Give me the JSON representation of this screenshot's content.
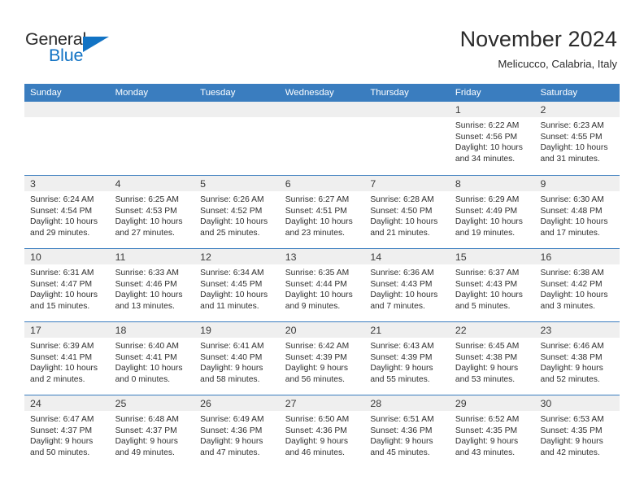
{
  "brand": {
    "name_part1": "General",
    "name_part2": "Blue",
    "color_dark": "#2b2b2b",
    "color_blue": "#1273c4"
  },
  "header": {
    "title": "November 2024",
    "location": "Melicucco, Calabria, Italy"
  },
  "theme": {
    "header_row_bg": "#3a7dbf",
    "day_band_bg": "#efefef",
    "row_divider": "#3a7dbf",
    "text": "#2b2b2b"
  },
  "weekdays": [
    "Sunday",
    "Monday",
    "Tuesday",
    "Wednesday",
    "Thursday",
    "Friday",
    "Saturday"
  ],
  "weeks": [
    [
      {
        "day": "",
        "sunrise": "",
        "sunset": "",
        "daylight_1": "",
        "daylight_2": ""
      },
      {
        "day": "",
        "sunrise": "",
        "sunset": "",
        "daylight_1": "",
        "daylight_2": ""
      },
      {
        "day": "",
        "sunrise": "",
        "sunset": "",
        "daylight_1": "",
        "daylight_2": ""
      },
      {
        "day": "",
        "sunrise": "",
        "sunset": "",
        "daylight_1": "",
        "daylight_2": ""
      },
      {
        "day": "",
        "sunrise": "",
        "sunset": "",
        "daylight_1": "",
        "daylight_2": ""
      },
      {
        "day": "1",
        "sunrise": "Sunrise: 6:22 AM",
        "sunset": "Sunset: 4:56 PM",
        "daylight_1": "Daylight: 10 hours",
        "daylight_2": "and 34 minutes."
      },
      {
        "day": "2",
        "sunrise": "Sunrise: 6:23 AM",
        "sunset": "Sunset: 4:55 PM",
        "daylight_1": "Daylight: 10 hours",
        "daylight_2": "and 31 minutes."
      }
    ],
    [
      {
        "day": "3",
        "sunrise": "Sunrise: 6:24 AM",
        "sunset": "Sunset: 4:54 PM",
        "daylight_1": "Daylight: 10 hours",
        "daylight_2": "and 29 minutes."
      },
      {
        "day": "4",
        "sunrise": "Sunrise: 6:25 AM",
        "sunset": "Sunset: 4:53 PM",
        "daylight_1": "Daylight: 10 hours",
        "daylight_2": "and 27 minutes."
      },
      {
        "day": "5",
        "sunrise": "Sunrise: 6:26 AM",
        "sunset": "Sunset: 4:52 PM",
        "daylight_1": "Daylight: 10 hours",
        "daylight_2": "and 25 minutes."
      },
      {
        "day": "6",
        "sunrise": "Sunrise: 6:27 AM",
        "sunset": "Sunset: 4:51 PM",
        "daylight_1": "Daylight: 10 hours",
        "daylight_2": "and 23 minutes."
      },
      {
        "day": "7",
        "sunrise": "Sunrise: 6:28 AM",
        "sunset": "Sunset: 4:50 PM",
        "daylight_1": "Daylight: 10 hours",
        "daylight_2": "and 21 minutes."
      },
      {
        "day": "8",
        "sunrise": "Sunrise: 6:29 AM",
        "sunset": "Sunset: 4:49 PM",
        "daylight_1": "Daylight: 10 hours",
        "daylight_2": "and 19 minutes."
      },
      {
        "day": "9",
        "sunrise": "Sunrise: 6:30 AM",
        "sunset": "Sunset: 4:48 PM",
        "daylight_1": "Daylight: 10 hours",
        "daylight_2": "and 17 minutes."
      }
    ],
    [
      {
        "day": "10",
        "sunrise": "Sunrise: 6:31 AM",
        "sunset": "Sunset: 4:47 PM",
        "daylight_1": "Daylight: 10 hours",
        "daylight_2": "and 15 minutes."
      },
      {
        "day": "11",
        "sunrise": "Sunrise: 6:33 AM",
        "sunset": "Sunset: 4:46 PM",
        "daylight_1": "Daylight: 10 hours",
        "daylight_2": "and 13 minutes."
      },
      {
        "day": "12",
        "sunrise": "Sunrise: 6:34 AM",
        "sunset": "Sunset: 4:45 PM",
        "daylight_1": "Daylight: 10 hours",
        "daylight_2": "and 11 minutes."
      },
      {
        "day": "13",
        "sunrise": "Sunrise: 6:35 AM",
        "sunset": "Sunset: 4:44 PM",
        "daylight_1": "Daylight: 10 hours",
        "daylight_2": "and 9 minutes."
      },
      {
        "day": "14",
        "sunrise": "Sunrise: 6:36 AM",
        "sunset": "Sunset: 4:43 PM",
        "daylight_1": "Daylight: 10 hours",
        "daylight_2": "and 7 minutes."
      },
      {
        "day": "15",
        "sunrise": "Sunrise: 6:37 AM",
        "sunset": "Sunset: 4:43 PM",
        "daylight_1": "Daylight: 10 hours",
        "daylight_2": "and 5 minutes."
      },
      {
        "day": "16",
        "sunrise": "Sunrise: 6:38 AM",
        "sunset": "Sunset: 4:42 PM",
        "daylight_1": "Daylight: 10 hours",
        "daylight_2": "and 3 minutes."
      }
    ],
    [
      {
        "day": "17",
        "sunrise": "Sunrise: 6:39 AM",
        "sunset": "Sunset: 4:41 PM",
        "daylight_1": "Daylight: 10 hours",
        "daylight_2": "and 2 minutes."
      },
      {
        "day": "18",
        "sunrise": "Sunrise: 6:40 AM",
        "sunset": "Sunset: 4:41 PM",
        "daylight_1": "Daylight: 10 hours",
        "daylight_2": "and 0 minutes."
      },
      {
        "day": "19",
        "sunrise": "Sunrise: 6:41 AM",
        "sunset": "Sunset: 4:40 PM",
        "daylight_1": "Daylight: 9 hours",
        "daylight_2": "and 58 minutes."
      },
      {
        "day": "20",
        "sunrise": "Sunrise: 6:42 AM",
        "sunset": "Sunset: 4:39 PM",
        "daylight_1": "Daylight: 9 hours",
        "daylight_2": "and 56 minutes."
      },
      {
        "day": "21",
        "sunrise": "Sunrise: 6:43 AM",
        "sunset": "Sunset: 4:39 PM",
        "daylight_1": "Daylight: 9 hours",
        "daylight_2": "and 55 minutes."
      },
      {
        "day": "22",
        "sunrise": "Sunrise: 6:45 AM",
        "sunset": "Sunset: 4:38 PM",
        "daylight_1": "Daylight: 9 hours",
        "daylight_2": "and 53 minutes."
      },
      {
        "day": "23",
        "sunrise": "Sunrise: 6:46 AM",
        "sunset": "Sunset: 4:38 PM",
        "daylight_1": "Daylight: 9 hours",
        "daylight_2": "and 52 minutes."
      }
    ],
    [
      {
        "day": "24",
        "sunrise": "Sunrise: 6:47 AM",
        "sunset": "Sunset: 4:37 PM",
        "daylight_1": "Daylight: 9 hours",
        "daylight_2": "and 50 minutes."
      },
      {
        "day": "25",
        "sunrise": "Sunrise: 6:48 AM",
        "sunset": "Sunset: 4:37 PM",
        "daylight_1": "Daylight: 9 hours",
        "daylight_2": "and 49 minutes."
      },
      {
        "day": "26",
        "sunrise": "Sunrise: 6:49 AM",
        "sunset": "Sunset: 4:36 PM",
        "daylight_1": "Daylight: 9 hours",
        "daylight_2": "and 47 minutes."
      },
      {
        "day": "27",
        "sunrise": "Sunrise: 6:50 AM",
        "sunset": "Sunset: 4:36 PM",
        "daylight_1": "Daylight: 9 hours",
        "daylight_2": "and 46 minutes."
      },
      {
        "day": "28",
        "sunrise": "Sunrise: 6:51 AM",
        "sunset": "Sunset: 4:36 PM",
        "daylight_1": "Daylight: 9 hours",
        "daylight_2": "and 45 minutes."
      },
      {
        "day": "29",
        "sunrise": "Sunrise: 6:52 AM",
        "sunset": "Sunset: 4:35 PM",
        "daylight_1": "Daylight: 9 hours",
        "daylight_2": "and 43 minutes."
      },
      {
        "day": "30",
        "sunrise": "Sunrise: 6:53 AM",
        "sunset": "Sunset: 4:35 PM",
        "daylight_1": "Daylight: 9 hours",
        "daylight_2": "and 42 minutes."
      }
    ]
  ]
}
